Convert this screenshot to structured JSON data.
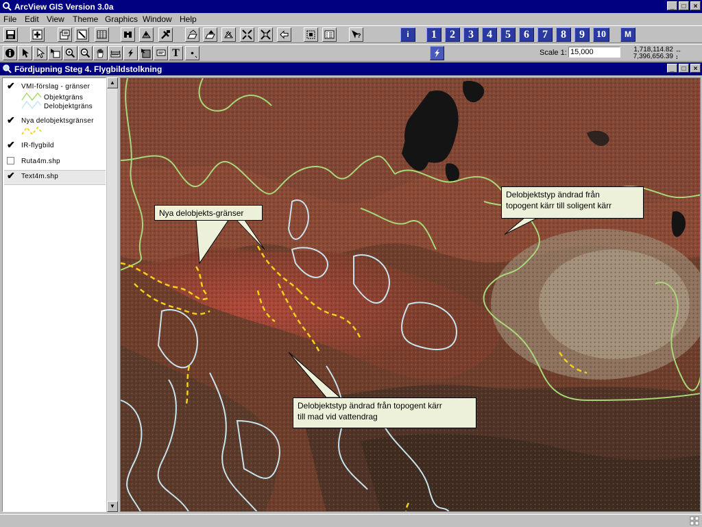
{
  "app": {
    "title": "ArcView GIS Version 3.0a"
  },
  "menu": [
    "File",
    "Edit",
    "View",
    "Theme",
    "Graphics",
    "Window",
    "Help"
  ],
  "toolbar1": {
    "icons": [
      "save-icon",
      "add-theme-icon",
      "theme-properties-icon",
      "edit-legend-icon",
      "open-table-icon",
      "find-icon",
      "locate-address-icon",
      "query-builder-icon",
      "zoom-full-extent-icon",
      "zoom-to-themes-icon",
      "zoom-to-selected-icon",
      "zoom-in-icon",
      "zoom-out-icon",
      "zoom-previous-icon",
      "select-by-theme-icon",
      "clear-selected-icon",
      "help-icon"
    ],
    "info_button": "i",
    "number_buttons": [
      "1",
      "2",
      "3",
      "4",
      "5",
      "6",
      "7",
      "8",
      "9",
      "10"
    ],
    "m_button": "M"
  },
  "toolbar2": {
    "tools": [
      "identify-icon",
      "pointer-icon",
      "vertex-edit-icon",
      "select-feature-icon",
      "zoom-in-tool-icon",
      "zoom-out-tool-icon",
      "pan-icon",
      "measure-icon",
      "hotlink-icon",
      "area-of-interest-icon",
      "label-icon",
      "text-tool-icon",
      "draw-point-icon"
    ],
    "text_tool_label": "T",
    "scale_label": "Scale 1:",
    "scale_value": "15,000",
    "coord_x": "1,718,114.82",
    "coord_y": "7,396,656.39"
  },
  "view": {
    "title": "Fördjupning Steg 4. Flygbildstolkning",
    "themes": [
      {
        "name": "VMI-förslag - gränser",
        "visible": true,
        "legend": [
          {
            "label": "Objektgräns",
            "color": "#a8d878"
          },
          {
            "label": "Delobjektgräns",
            "color": "#c8e4ee"
          }
        ]
      },
      {
        "name": "Nya delobjektsgränser",
        "visible": true,
        "legend": [
          {
            "label": "",
            "color": "#f2d21a"
          }
        ]
      },
      {
        "name": "IR-flygbild",
        "visible": true,
        "legend": []
      },
      {
        "name": "Ruta4m.shp",
        "visible": false,
        "legend": []
      },
      {
        "name": "Text4m.shp",
        "visible": true,
        "legend": []
      }
    ],
    "callouts": [
      {
        "text": "Nya delobjekts-gränser"
      },
      {
        "line1": "Delobjektstyp ändrad från",
        "line2": "topogent kärr till soligent kärr"
      },
      {
        "line1": "Delobjektstyp ändrad från topogent kärr",
        "line2": "till mad vid vattendrag"
      }
    ]
  },
  "colors": {
    "titlebar": "#000080",
    "objektgrans": "#a8d878",
    "delobjektgrans": "#c8e4ee",
    "nya_grans": "#f2d21a",
    "callout_bg": "#eef1d9",
    "numbutton": "#2b3aa0"
  }
}
